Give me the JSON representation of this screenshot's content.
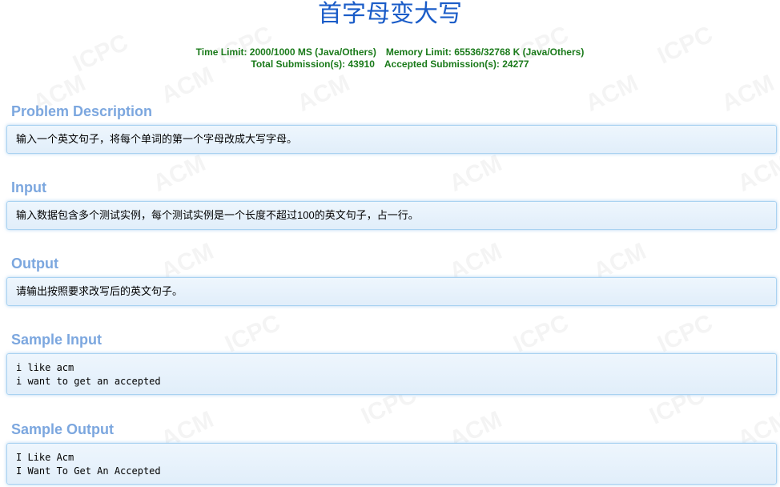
{
  "problem": {
    "title": "首字母变大写",
    "time_limit": "Time Limit: 2000/1000 MS (Java/Others)",
    "memory_limit": "Memory Limit: 65536/32768 K (Java/Others)",
    "total_submissions": "Total Submission(s): 43910",
    "accepted_submissions": "Accepted Submission(s): 24277"
  },
  "sections": {
    "description": {
      "heading": "Problem Description",
      "content": "输入一个英文句子，将每个单词的第一个字母改成大写字母。"
    },
    "input": {
      "heading": "Input",
      "content": "输入数据包含多个测试实例，每个测试实例是一个长度不超过100的英文句子，占一行。"
    },
    "output": {
      "heading": "Output",
      "content": "请输出按照要求改写后的英文句子。"
    },
    "sample_input": {
      "heading": "Sample Input",
      "lines": [
        "i like acm",
        "i want to get an accepted"
      ]
    },
    "sample_output": {
      "heading": "Sample Output",
      "lines": [
        "I Like Acm",
        "I Want To Get An Accepted"
      ]
    }
  },
  "watermark": [
    "ACM",
    "ICPC"
  ],
  "colors": {
    "title": "#1a5cc8",
    "meta": "#1a7a1a",
    "section_heading": "#7ca7df",
    "panel_border": "#a9d2f1",
    "panel_background": "#e8f2fb"
  }
}
